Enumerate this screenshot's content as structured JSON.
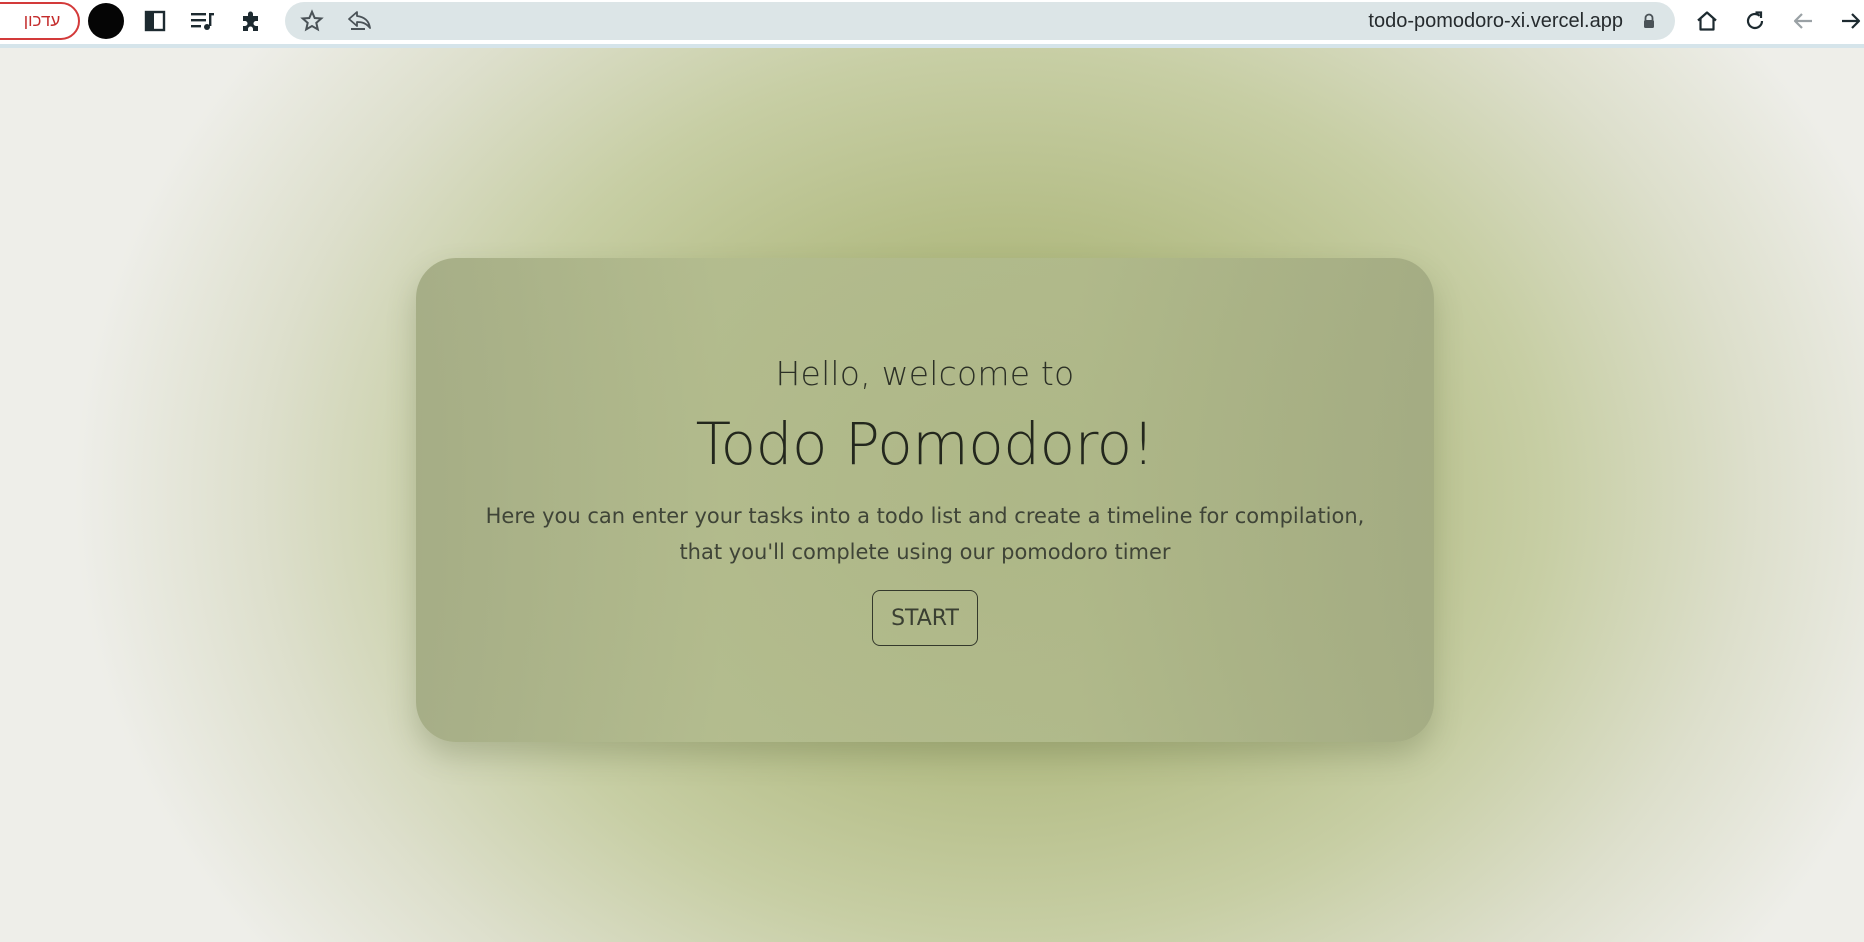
{
  "browser": {
    "update_label": "עדכון",
    "url": "todo-pomodoro-xi.vercel.app",
    "icons": [
      "profile-avatar",
      "sidebar-icon",
      "playlist-icon",
      "extensions-icon",
      "star-icon",
      "share-icon",
      "lock-icon",
      "home-icon",
      "reload-icon",
      "back-arrow-icon",
      "forward-arrow-icon"
    ],
    "update_color": "#d33a3a"
  },
  "main": {
    "greeting": "Hello, welcome to",
    "title": "Todo Pomodoro!",
    "description": "Here you can enter your tasks into a todo list and create a timeline for compilation, that you'll complete using our pomodoro timer",
    "start_button": "START"
  },
  "colors": {
    "background_center": "#9fa96a",
    "background_edge": "#eeeee9",
    "card": "#aab38a",
    "text": "#23271d"
  }
}
